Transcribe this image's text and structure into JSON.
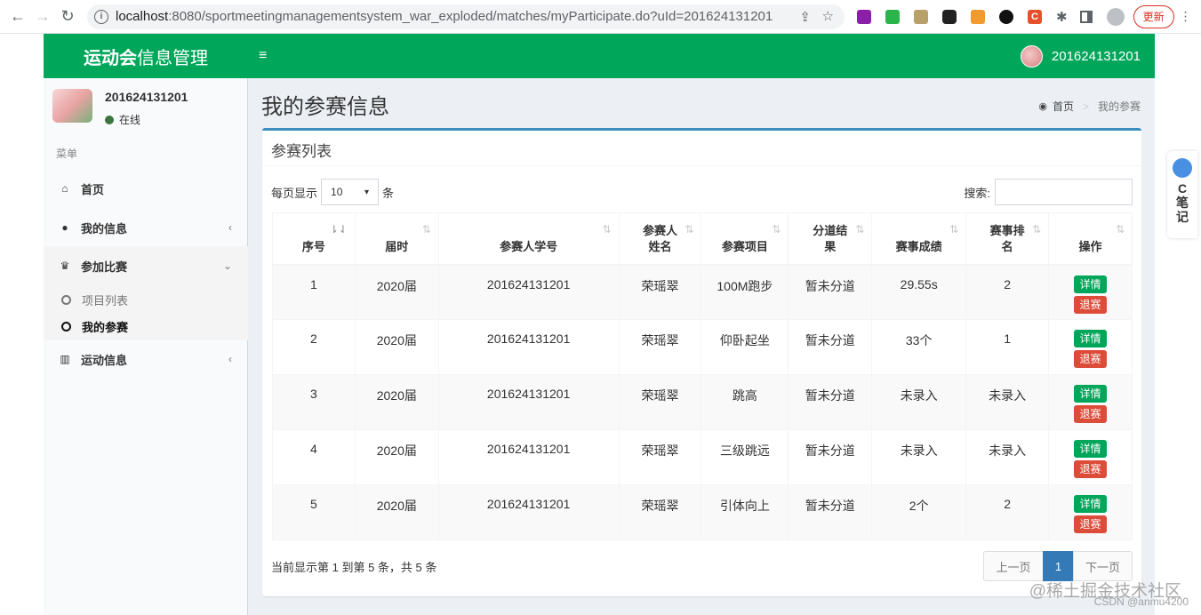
{
  "browser": {
    "url_host": "localhost",
    "url_path": ":8080/sportmeetingmanagementsystem_war_exploded/matches/myParticipate.do?uId=201624131201",
    "update_label": "更新"
  },
  "header": {
    "logo_bold": "运动会",
    "logo_rest": "信息管理",
    "user": "201624131201"
  },
  "sidebar": {
    "user_name": "201624131201",
    "status": "在线",
    "menu_header": "菜单",
    "items": [
      {
        "label": "首页",
        "icon": "home-icon"
      },
      {
        "label": "我的信息",
        "icon": "user-icon"
      },
      {
        "label": "参加比赛",
        "icon": "trophy-icon"
      },
      {
        "label": "运动信息",
        "icon": "bar-chart-icon"
      }
    ],
    "sub_items": [
      "项目列表",
      "我的参赛"
    ]
  },
  "content": {
    "title": "我的参赛信息",
    "breadcrumb": [
      "首页",
      "我的参赛"
    ]
  },
  "box": {
    "title": "参赛列表",
    "length_prefix": "每页显示",
    "length_value": "10",
    "length_suffix": "条",
    "search_label": "搜索:",
    "search_value": ""
  },
  "table": {
    "headers": [
      "序号",
      "届时",
      "参赛人学号",
      "参赛人姓名",
      "参赛项目",
      "分道结果",
      "赛事成绩",
      "赛事排名",
      "操作"
    ],
    "rows": [
      [
        "1",
        "2020届",
        "201624131201",
        "荣瑶翠",
        "100M跑步",
        "暂未分道",
        "29.55s",
        "2"
      ],
      [
        "2",
        "2020届",
        "201624131201",
        "荣瑶翠",
        "仰卧起坐",
        "暂未分道",
        "33个",
        "1"
      ],
      [
        "3",
        "2020届",
        "201624131201",
        "荣瑶翠",
        "跳高",
        "暂未分道",
        "未录入",
        "未录入"
      ],
      [
        "4",
        "2020届",
        "201624131201",
        "荣瑶翠",
        "三级跳远",
        "暂未分道",
        "未录入",
        "未录入"
      ],
      [
        "5",
        "2020届",
        "201624131201",
        "荣瑶翠",
        "引体向上",
        "暂未分道",
        "2个",
        "2"
      ]
    ],
    "detail_label": "详情",
    "quit_label": "退赛"
  },
  "footer": {
    "info": "当前显示第 1 到第 5 条，共 5 条",
    "prev": "上一页",
    "page": "1",
    "next": "下一页"
  },
  "float_note": {
    "text": "C笔记"
  },
  "watermark": {
    "line1": "@稀土掘金技术社区",
    "line2": "CSDN @anmu4200"
  },
  "colors": {
    "brand_green": "#00a65a",
    "accent_blue": "#3c8dbc",
    "danger_red": "#dd4b39",
    "pager_blue": "#337ab7"
  }
}
